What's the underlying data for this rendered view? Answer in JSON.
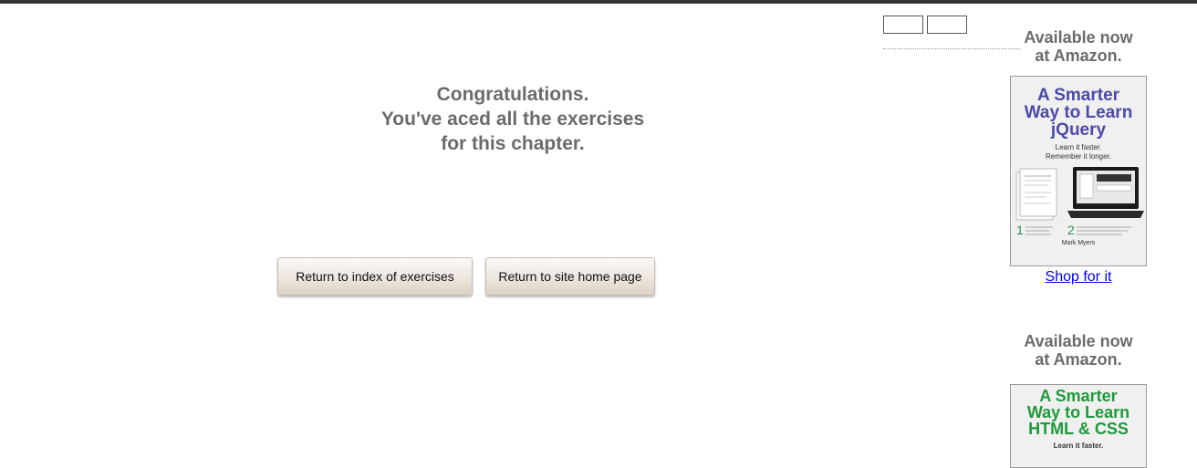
{
  "congrats": {
    "line1": "Congratulations.",
    "line2": "You've aced all the exercises",
    "line3": "for this chapter."
  },
  "buttons": {
    "index": "Return to index of exercises",
    "home": "Return to site home page"
  },
  "sidebar": {
    "ad1": {
      "available_line1": "Available now",
      "available_line2": "at Amazon.",
      "book_title_line1": "A Smarter",
      "book_title_line2": "Way to Learn",
      "book_title_line3": "jQuery",
      "tagline1": "Learn it faster.",
      "tagline2": "Remember it longer.",
      "step1_num": "1",
      "step2_num": "2",
      "author": "Mark Myers",
      "link": "Shop for it",
      "title_color": "#4a4aa8",
      "step_color": "#2e8b57"
    },
    "ad2": {
      "available_line1": "Available now",
      "available_line2": "at Amazon.",
      "book_title_line1": "A Smarter",
      "book_title_line2": "Way to Learn",
      "book_title_line3": "HTML & CSS",
      "tagline1": "Learn it faster.",
      "title_color": "#1e9a3a"
    }
  }
}
